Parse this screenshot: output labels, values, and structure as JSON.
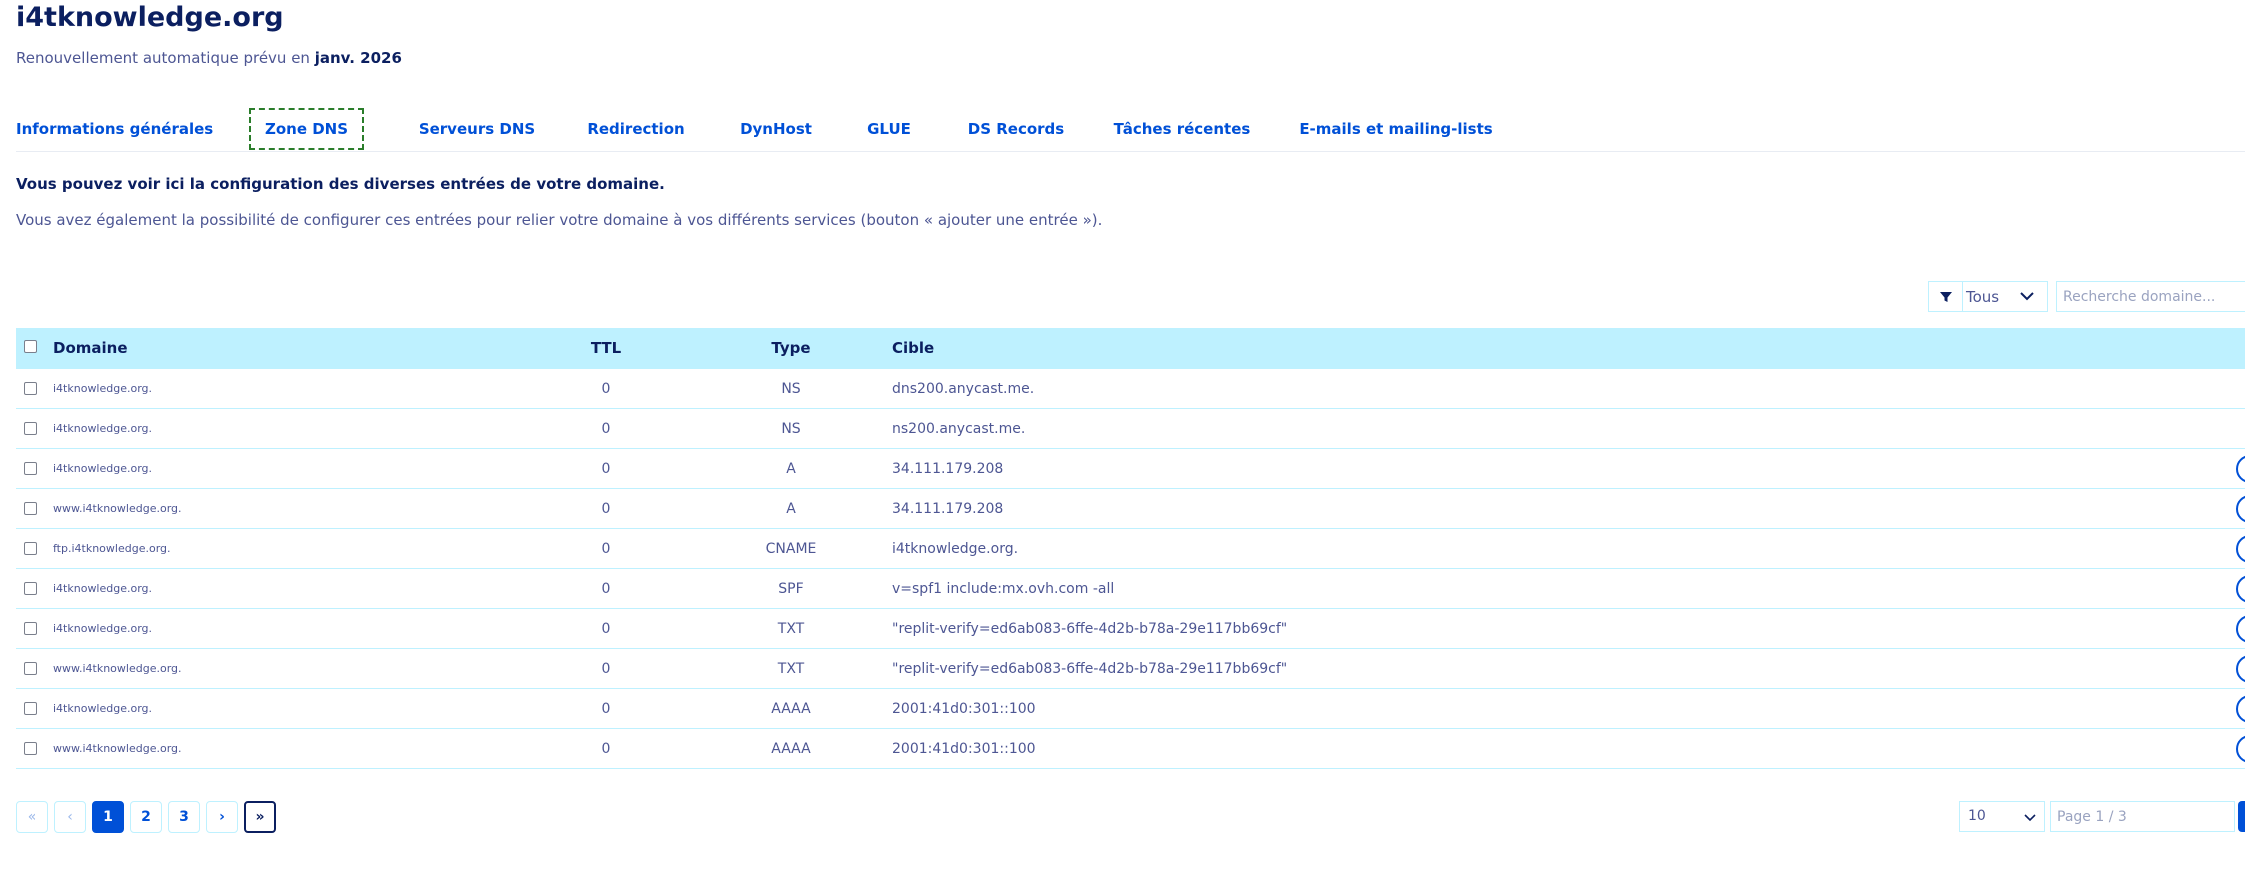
{
  "header": {
    "title": "i4tknowledge.org",
    "renew_prefix": "Renouvellement automatique prévu en",
    "renew_date": "janv. 2026"
  },
  "tabs": [
    {
      "label": "Informations générales",
      "active": false
    },
    {
      "label": "Zone DNS",
      "active": true
    },
    {
      "label": "Serveurs DNS",
      "active": false
    },
    {
      "label": "Redirection",
      "active": false
    },
    {
      "label": "DynHost",
      "active": false
    },
    {
      "label": "GLUE",
      "active": false
    },
    {
      "label": "DS Records",
      "active": false
    },
    {
      "label": "Tâches récentes",
      "active": false
    },
    {
      "label": "E-mails et mailing-lists",
      "active": false
    }
  ],
  "intro": {
    "bold": "Vous pouvez voir ici la configuration des diverses entrées de votre domaine.",
    "text": "Vous avez également la possibilité de configurer ces entrées pour relier votre domaine à vos différents services (bouton « ajouter une entrée »)."
  },
  "filter": {
    "icon": "filter-icon",
    "value": "Tous",
    "search_placeholder": "Recherche domaine..."
  },
  "table": {
    "columns": [
      "Domaine",
      "TTL",
      "Type",
      "Cible"
    ],
    "rows": [
      {
        "domain": "i4tknowledge.org.",
        "ttl": "0",
        "type": "NS",
        "target": "dns200.anycast.me.",
        "has_action": false
      },
      {
        "domain": "i4tknowledge.org.",
        "ttl": "0",
        "type": "NS",
        "target": "ns200.anycast.me.",
        "has_action": false
      },
      {
        "domain": "i4tknowledge.org.",
        "ttl": "0",
        "type": "A",
        "target": "34.111.179.208",
        "has_action": true
      },
      {
        "domain": "www.i4tknowledge.org.",
        "ttl": "0",
        "type": "A",
        "target": "34.111.179.208",
        "has_action": true
      },
      {
        "domain": "ftp.i4tknowledge.org.",
        "ttl": "0",
        "type": "CNAME",
        "target": "i4tknowledge.org.",
        "has_action": true
      },
      {
        "domain": "i4tknowledge.org.",
        "ttl": "0",
        "type": "SPF",
        "target": "v=spf1 include:mx.ovh.com -all",
        "has_action": true
      },
      {
        "domain": "i4tknowledge.org.",
        "ttl": "0",
        "type": "TXT",
        "target": "\"replit-verify=ed6ab083-6ffe-4d2b-b78a-29e117bb69cf\"",
        "has_action": true
      },
      {
        "domain": "www.i4tknowledge.org.",
        "ttl": "0",
        "type": "TXT",
        "target": "\"replit-verify=ed6ab083-6ffe-4d2b-b78a-29e117bb69cf\"",
        "has_action": true
      },
      {
        "domain": "i4tknowledge.org.",
        "ttl": "0",
        "type": "AAAA",
        "target": "2001:41d0:301::100",
        "has_action": true
      },
      {
        "domain": "www.i4tknowledge.org.",
        "ttl": "0",
        "type": "AAAA",
        "target": "2001:41d0:301::100",
        "has_action": true
      }
    ]
  },
  "pagination": {
    "first": "«",
    "prev": "‹",
    "pages": [
      "1",
      "2",
      "3"
    ],
    "current": "1",
    "next": "›",
    "last": "»",
    "page_size": "10",
    "page_placeholder": "Page 1 / 3"
  },
  "colors": {
    "accent": "#0050d7",
    "header_bg": "#bef1ff",
    "title": "#0b1f60",
    "text": "#4d5693",
    "active_tab_border": "#2a7d2a"
  }
}
